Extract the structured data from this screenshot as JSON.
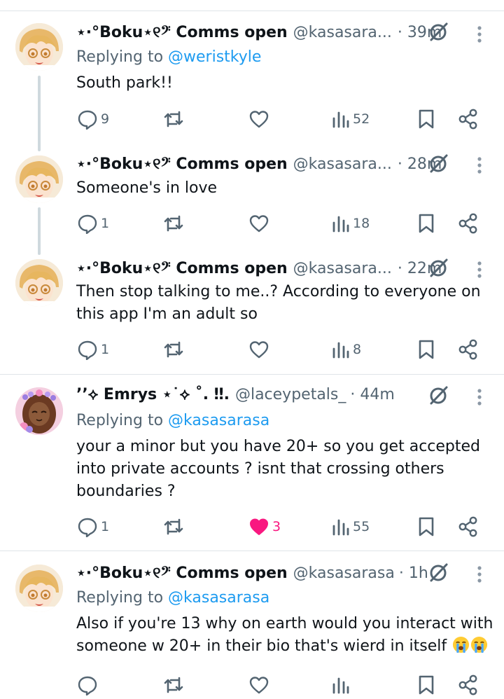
{
  "colors": {
    "text": "#0f1419",
    "secondary": "#536471",
    "link": "#1d9bf0",
    "like_active": "#f91880",
    "divider": "#dfe4e8",
    "thread_line": "#cfd9de"
  },
  "tweets": [
    {
      "name": "⋆·°Boku⋆୧𝄢 Comms open",
      "handle": "@kasasara...",
      "time": "· 39m",
      "reply_label": "Replying to ",
      "reply_mention": "@weristkyle",
      "text": "South park!!",
      "counts": {
        "replies": "9",
        "retweets": "",
        "likes": "",
        "views": "52"
      },
      "liked": false,
      "avatar_icon": "anime-avatar-blonde-glasses"
    },
    {
      "name": "⋆·°Boku⋆୧𝄢 Comms open",
      "handle": "@kasasara...",
      "time": "· 28m",
      "reply_label": "",
      "reply_mention": "",
      "text": "Someone's in love",
      "counts": {
        "replies": "1",
        "retweets": "",
        "likes": "",
        "views": "18"
      },
      "liked": false,
      "avatar_icon": "anime-avatar-blonde-glasses"
    },
    {
      "name": "⋆·°Boku⋆୧𝄢 Comms open",
      "handle": "@kasasara...",
      "time": "· 22m",
      "reply_label": "",
      "reply_mention": "",
      "text": "Then stop talking to me..? According to everyone on this app I'm an adult so",
      "counts": {
        "replies": "1",
        "retweets": "",
        "likes": "",
        "views": "8"
      },
      "liked": false,
      "avatar_icon": "anime-avatar-blonde-glasses"
    },
    {
      "name": "ʼʼ⟡ Emrys ⋆˙⟡ ˚. ‼︎.",
      "handle": "@laceypetals_",
      "time": "· 44m",
      "reply_label": "Replying to ",
      "reply_mention": "@kasasarasa",
      "text": "your a minor but you have 20+ so you get accepted into private accounts ? isnt that crossing others boundaries ?",
      "counts": {
        "replies": "1",
        "retweets": "",
        "likes": "3",
        "views": "55"
      },
      "liked": true,
      "avatar_icon": "avatar-flower-girl"
    },
    {
      "name": "⋆·°Boku⋆୧𝄢 Comms open",
      "handle": "@kasasarasa",
      "time": "· 1h",
      "reply_label": "Replying to ",
      "reply_mention": "@kasasarasa",
      "text": "Also if you're 13 why on earth would you interact with someone w 20+ in their bio that's wierd in itself",
      "emoji": "loudly-crying-face-emoji",
      "counts": {
        "replies": "",
        "retweets": "",
        "likes": "",
        "views": ""
      },
      "liked": false,
      "avatar_icon": "anime-avatar-blonde-glasses"
    }
  ]
}
